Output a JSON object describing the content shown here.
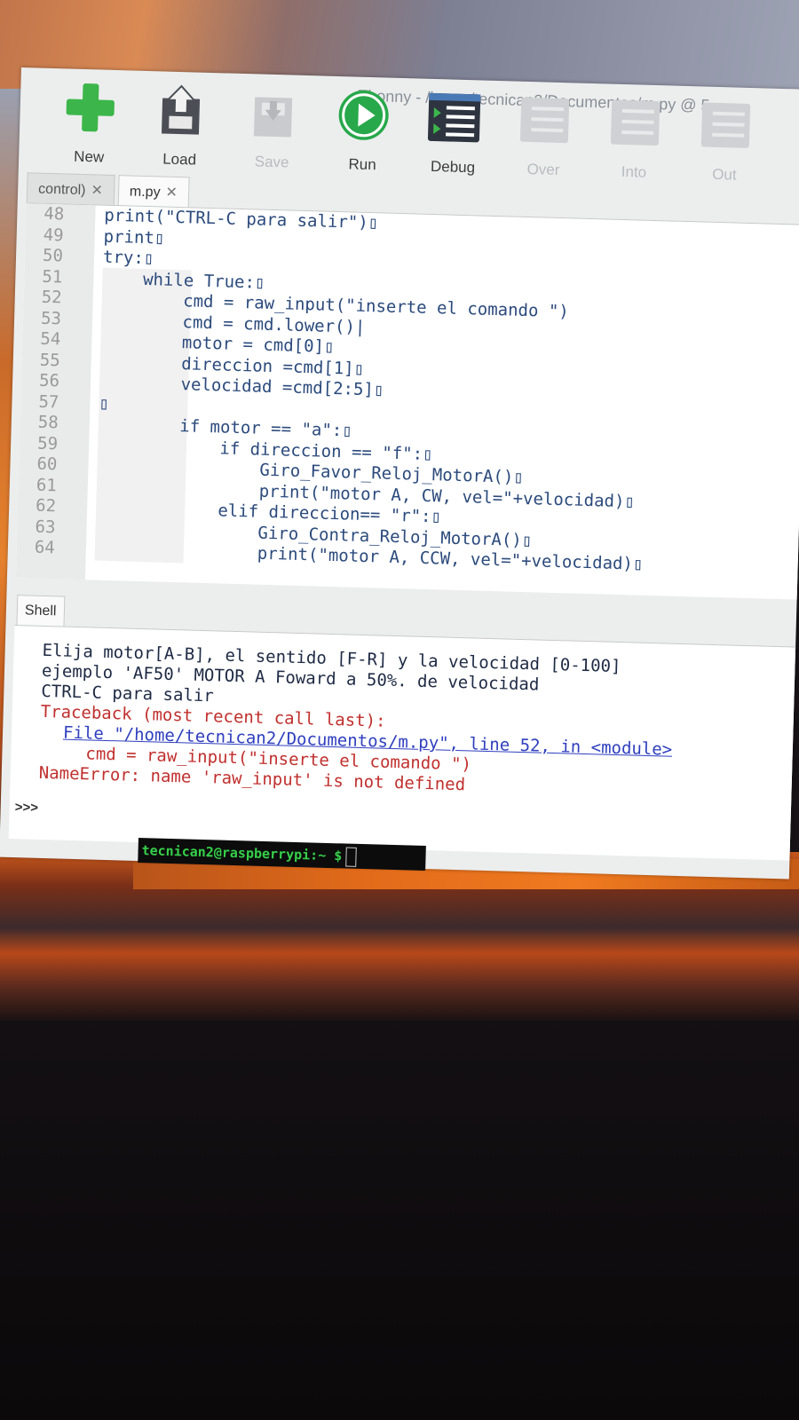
{
  "window": {
    "title": "Thonny  -  /home/tecnican2/Documentos/m.py  @  5"
  },
  "toolbar": [
    {
      "label": "New",
      "icon": "new-icon",
      "enabled": true
    },
    {
      "label": "Load",
      "icon": "load-icon",
      "enabled": true
    },
    {
      "label": "Save",
      "icon": "save-icon",
      "enabled": false
    },
    {
      "label": "Run",
      "icon": "run-icon",
      "enabled": true
    },
    {
      "label": "Debug",
      "icon": "debug-icon",
      "enabled": true
    },
    {
      "label": "Over",
      "icon": "step-over-icon",
      "enabled": false
    },
    {
      "label": "Into",
      "icon": "step-into-icon",
      "enabled": false
    },
    {
      "label": "Out",
      "icon": "step-out-icon",
      "enabled": false
    }
  ],
  "tabs": [
    {
      "label": "control)",
      "close": "✕"
    },
    {
      "label": "m.py",
      "close": "✕"
    }
  ],
  "editor": {
    "lines": [
      {
        "no": "48",
        "text": "print(\"CTRL-C para salir\")▯"
      },
      {
        "no": "49",
        "text": "print▯"
      },
      {
        "no": "50",
        "text": "try:▯"
      },
      {
        "no": "51",
        "text": "    while True:▯"
      },
      {
        "no": "52",
        "text": "        cmd = raw_input(\"inserte el comando \")"
      },
      {
        "no": "53",
        "text": "        cmd = cmd.lower()|"
      },
      {
        "no": "54",
        "text": "        motor = cmd[0]▯"
      },
      {
        "no": "55",
        "text": "        direccion =cmd[1]▯"
      },
      {
        "no": "56",
        "text": "        velocidad =cmd[2:5]▯"
      },
      {
        "no": "57",
        "text": "▯"
      },
      {
        "no": "58",
        "text": "        if motor == \"a\":▯"
      },
      {
        "no": "59",
        "text": "            if direccion == \"f\":▯"
      },
      {
        "no": "60",
        "text": "                Giro_Favor_Reloj_MotorA()▯"
      },
      {
        "no": "61",
        "text": "                print(\"motor A, CW, vel=\"+velocidad)▯"
      },
      {
        "no": "62",
        "text": "            elif direccion== \"r\":▯"
      },
      {
        "no": "63",
        "text": "                Giro_Contra_Reloj_MotorA()▯"
      },
      {
        "no": "64",
        "text": "                print(\"motor A, CCW, vel=\"+velocidad)▯"
      }
    ]
  },
  "shell": {
    "tab_label": "Shell",
    "output": [
      "Elija motor[A-B], el sentido [F-R] y la velocidad [0-100]",
      "ejemplo 'AF50' MOTOR A Foward a 50%. de velocidad",
      "CTRL-C para salir"
    ],
    "traceback": {
      "header": "Traceback (most recent call last):",
      "file_line": "File \"/home/tecnican2/Documentos/m.py\", line 52, in <module>",
      "code_line": "cmd = raw_input(\"inserte el comando \")",
      "error": "NameError: name 'raw_input' is not defined"
    },
    "prompt": ">>>"
  },
  "terminal": {
    "prompt": "tecnican2@raspberrypi:~ $"
  },
  "colors": {
    "run_green": "#27a84a",
    "new_green": "#3cb64a",
    "error_red": "#c0302e",
    "link_blue": "#2f3fbf",
    "terminal_green": "#36d04a"
  }
}
